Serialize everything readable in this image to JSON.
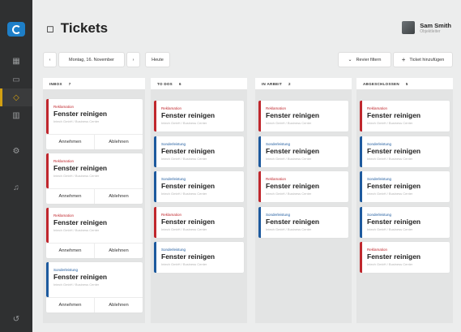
{
  "header": {
    "title": "Tickets",
    "user_name": "Sam Smith",
    "user_role": "Objektleiter"
  },
  "sidebar": {
    "items": [
      {
        "icon": "dashboard-icon",
        "glyph": "▦"
      },
      {
        "icon": "calendar-icon",
        "glyph": "▭"
      },
      {
        "icon": "tickets-icon",
        "glyph": "◇"
      },
      {
        "icon": "reports-icon",
        "glyph": "▥"
      },
      {
        "icon": "settings-icon",
        "glyph": "⚙"
      },
      {
        "icon": "notifications-icon",
        "glyph": "♫"
      },
      {
        "icon": "logout-icon",
        "glyph": "↺"
      }
    ]
  },
  "toolbar": {
    "prev_label": "‹",
    "date_label": "Montag, 16. November",
    "next_label": "›",
    "today_label": "Heute",
    "filter_label": "Revier filtern",
    "add_label": "Ticket hinzufügen"
  },
  "actions": {
    "accept": "Annehmen",
    "reject": "Ablehnen"
  },
  "colors": {
    "reklamation": "#c0272d",
    "sonderleistung": "#1d5a9e",
    "active": "#d3a012"
  },
  "columns": [
    {
      "title": "INBOX",
      "count": "7",
      "cards": [
        {
          "category": "Reklamation",
          "title": "Fenster reinigen",
          "subtitle": "Intech GmbH / Business Center"
        },
        {
          "category": "Reklamation",
          "title": "Fenster reinigen",
          "subtitle": "Intech GmbH / Business Center"
        },
        {
          "category": "Reklamation",
          "title": "Fenster reinigen",
          "subtitle": "Intech GmbH / Business Center"
        },
        {
          "category": "Sonderleistung",
          "title": "Fenster reinigen",
          "subtitle": "Intech GmbH / Business Center"
        }
      ]
    },
    {
      "title": "TO DOS",
      "count": "6",
      "cards": [
        {
          "category": "Reklamation",
          "title": "Fenster reinigen",
          "subtitle": "Intech GmbH / Business Center"
        },
        {
          "category": "Sonderleistung",
          "title": "Fenster reinigen",
          "subtitle": "Intech GmbH / Business Center"
        },
        {
          "category": "Sonderleistung",
          "title": "Fenster reinigen",
          "subtitle": "Intech GmbH / Business Center"
        },
        {
          "category": "Reklamation",
          "title": "Fenster reinigen",
          "subtitle": "Intech GmbH / Business Center"
        },
        {
          "category": "Sonderleistung",
          "title": "Fenster reinigen",
          "subtitle": "Intech GmbH / Business Center"
        }
      ]
    },
    {
      "title": "IN ARBEIT",
      "count": "2",
      "cards": [
        {
          "category": "Reklamation",
          "title": "Fenster reinigen",
          "subtitle": "Intech GmbH / Business Center"
        },
        {
          "category": "Sonderleistung",
          "title": "Fenster reinigen",
          "subtitle": "Intech GmbH / Business Center"
        },
        {
          "category": "Reklamation",
          "title": "Fenster reinigen",
          "subtitle": "Intech GmbH / Business Center"
        },
        {
          "category": "Sonderleistung",
          "title": "Fenster reinigen",
          "subtitle": "Intech GmbH / Business Center"
        }
      ]
    },
    {
      "title": "ABGESCHLOSSEN",
      "count": "5",
      "cards": [
        {
          "category": "Reklamation",
          "title": "Fenster reinigen",
          "subtitle": "Intech GmbH / Business Center"
        },
        {
          "category": "Sonderleistung",
          "title": "Fenster reinigen",
          "subtitle": "Intech GmbH / Business Center"
        },
        {
          "category": "Sonderleistung",
          "title": "Fenster reinigen",
          "subtitle": "Intech GmbH / Business Center"
        },
        {
          "category": "Sonderleistung",
          "title": "Fenster reinigen",
          "subtitle": "Intech GmbH / Business Center"
        },
        {
          "category": "Reklamation",
          "title": "Fenster reinigen",
          "subtitle": "Intech GmbH / Business Center"
        }
      ]
    }
  ]
}
